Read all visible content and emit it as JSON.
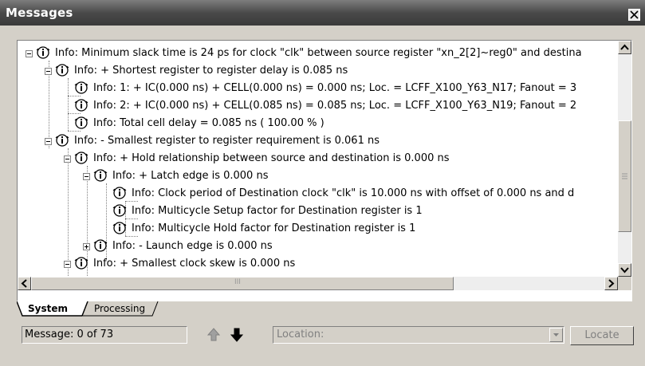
{
  "window": {
    "title": "Messages"
  },
  "messages": [
    {
      "text": "Info: Minimum slack time is 24 ps for clock \"clk\" between source register \"xn_2[2]~reg0\" and destina"
    },
    {
      "text": "Info: + Shortest register to register delay is 0.085 ns"
    },
    {
      "text": "Info: 1: + IC(0.000 ns) + CELL(0.000 ns) = 0.000 ns; Loc. = LCFF_X100_Y63_N17; Fanout = 3"
    },
    {
      "text": "Info: 2: + IC(0.000 ns) + CELL(0.085 ns) = 0.085 ns; Loc. = LCFF_X100_Y63_N19; Fanout = 2"
    },
    {
      "text": "Info: Total cell delay = 0.085 ns ( 100.00 % )"
    },
    {
      "text": "Info: - Smallest register to register requirement is 0.061 ns"
    },
    {
      "text": "Info: + Hold relationship between source and destination is 0.000 ns"
    },
    {
      "text": "Info: + Latch edge is 0.000 ns"
    },
    {
      "text": "Info: Clock period of Destination clock \"clk\" is 10.000 ns with  offset of 0.000 ns and d"
    },
    {
      "text": "Info: Multicycle Setup factor for Destination register is 1"
    },
    {
      "text": "Info: Multicycle Hold factor for Destination register is 1"
    },
    {
      "text": "Info: - Launch edge is 0.000 ns"
    },
    {
      "text": "Info: + Smallest clock skew is 0.000 ns"
    }
  ],
  "tabs": {
    "system": "System",
    "processing": "Processing"
  },
  "status": {
    "message_count": "Message: 0 of 73"
  },
  "location": {
    "placeholder": "Location:"
  },
  "buttons": {
    "locate": "Locate"
  },
  "scrollbar": {
    "horizontal_grip": "III"
  },
  "icons": {
    "close": "close-icon",
    "info": "info-icon",
    "prev": "prev-message-icon",
    "next": "next-message-icon",
    "dropdown": "chevron-down-icon"
  }
}
